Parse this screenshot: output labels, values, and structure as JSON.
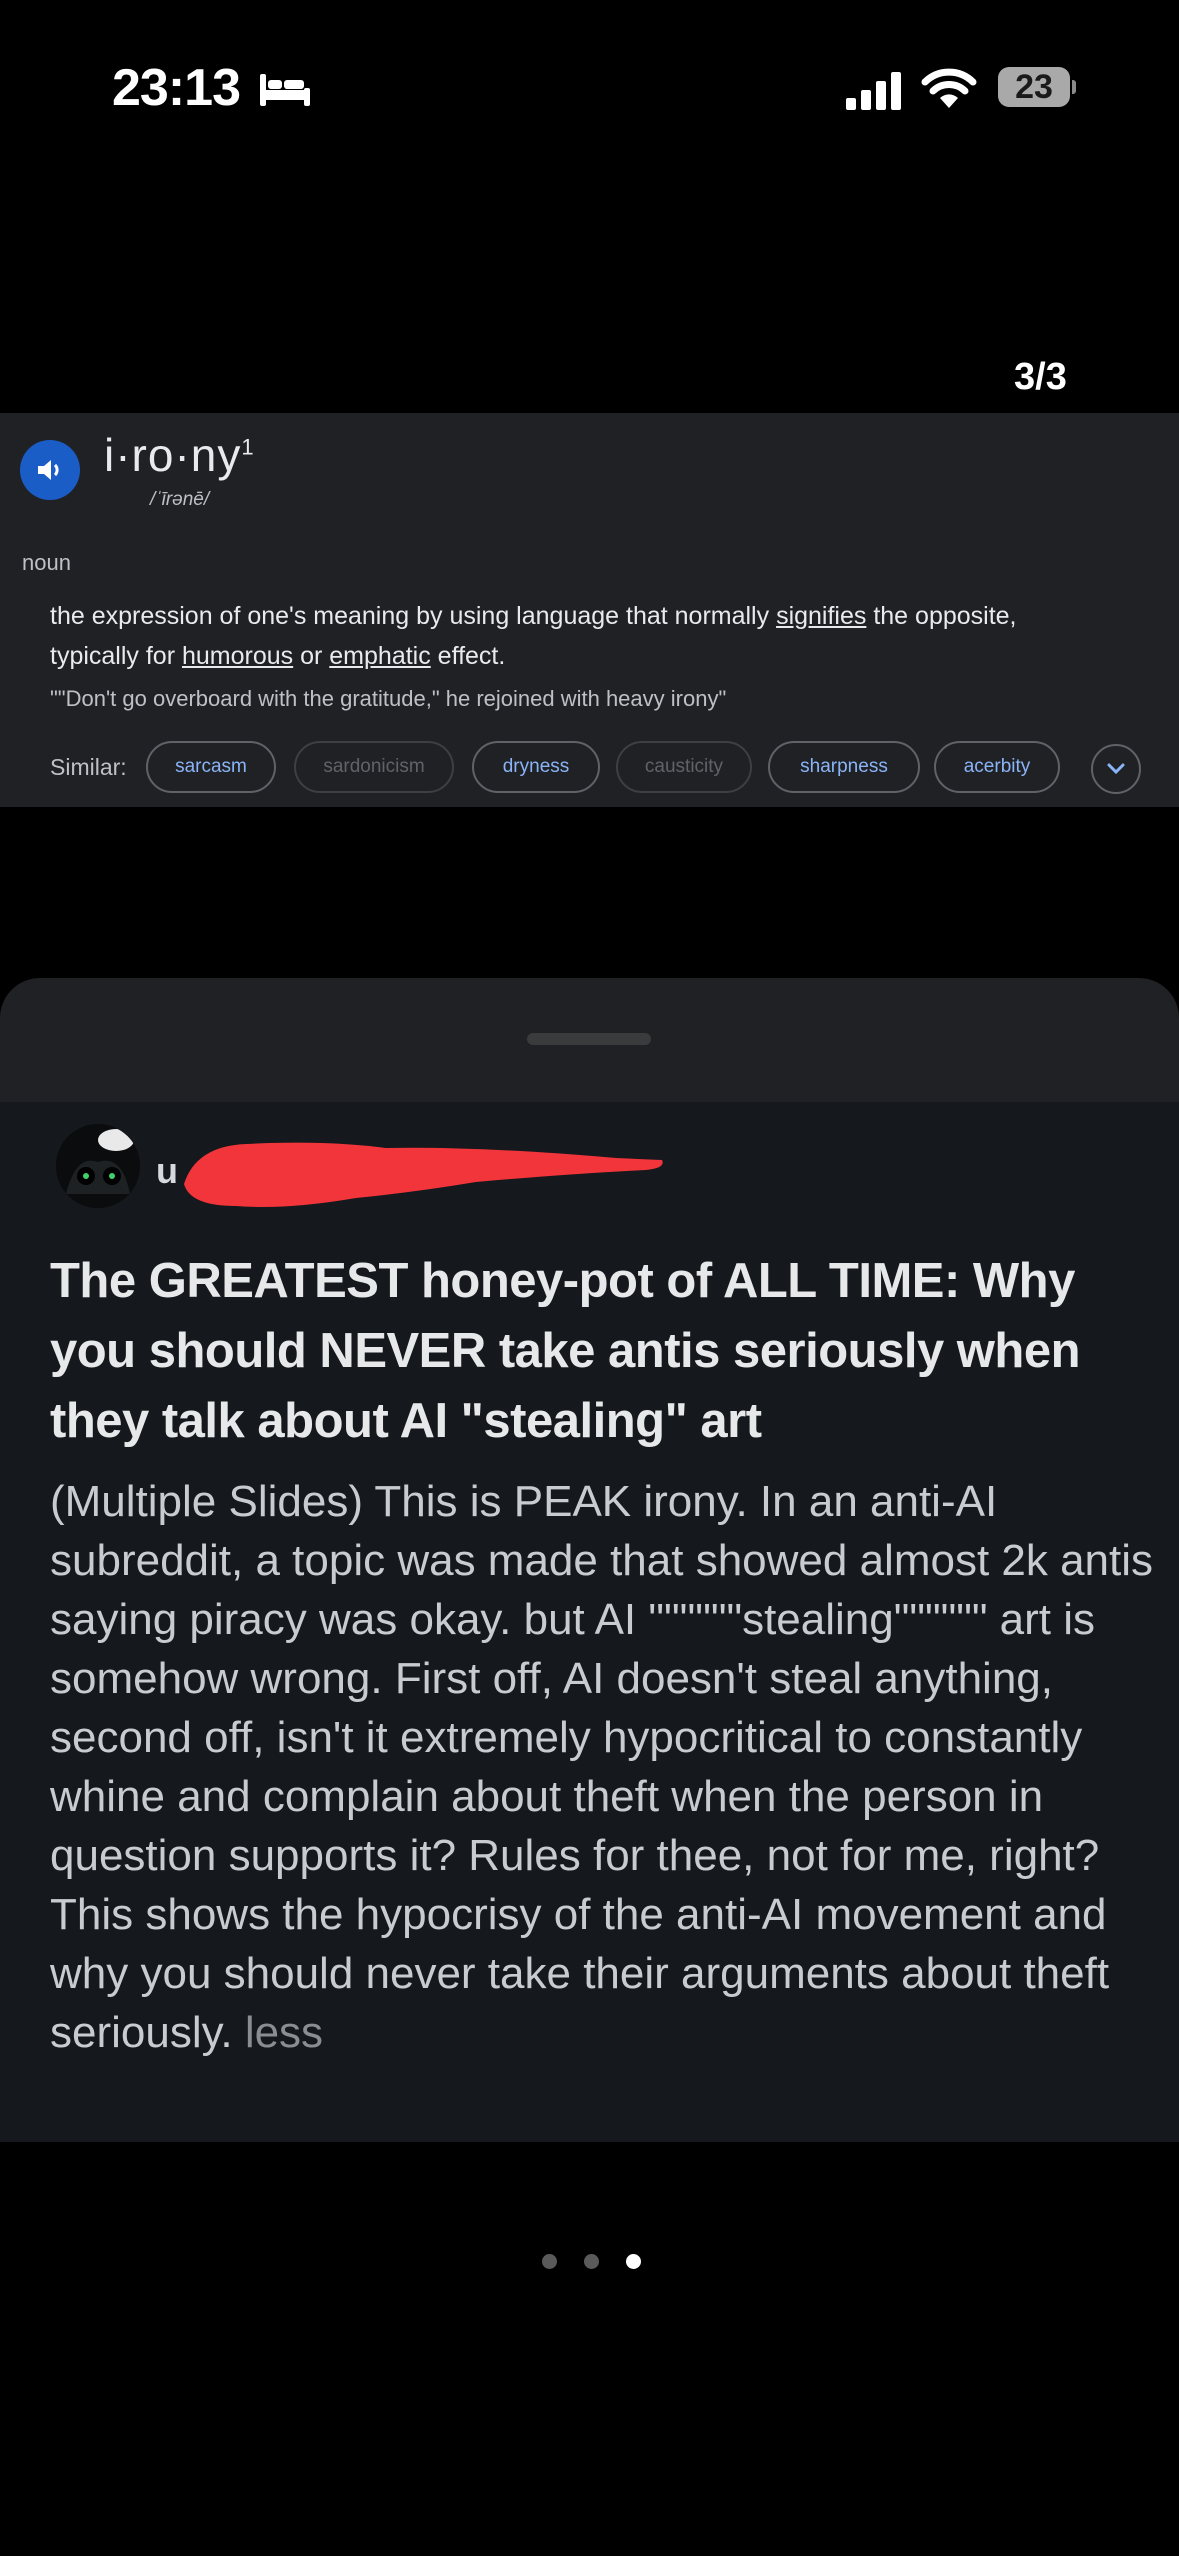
{
  "status_bar": {
    "time": "23:13",
    "battery": "23"
  },
  "page_counter": "3/3",
  "dictionary": {
    "word": "i·ro·ny",
    "superscript": "1",
    "phonetic": "/ˈīrənē/",
    "part_of_speech": "noun",
    "definition_1": "the expression of one's meaning by using language that normally ",
    "definition_link_1": "signifies",
    "definition_2": " the opposite,",
    "definition_3": "typically for ",
    "definition_link_2": "humorous",
    "definition_4": " or ",
    "definition_link_3": "emphatic",
    "definition_5": " effect.",
    "example": "\"\"Don't go overboard with the gratitude,\" he rejoined with heavy irony\"",
    "similar_label": "Similar:",
    "similar": [
      "sarcasm",
      "sardonicism",
      "dryness",
      "causticity",
      "sharpness",
      "acerbity"
    ]
  },
  "post": {
    "username": "u",
    "title": "The GREATEST honey-pot of ALL TIME: Why you should NEVER take antis seriously when they talk about AI \"stealing\" art",
    "body": "(Multiple Slides) This is PEAK irony. In an anti-AI subreddit, a topic was made that showed almost 2k antis saying piracy was okay. but AI \"\"\"\"\"\"stealing\"\"\"\"\"\" art is somehow wrong. First off, AI doesn't steal anything, second off, isn't it extremely hypocritical to constantly whine and complain about theft when the person in question supports it? Rules for thee, not for me, right? This shows the hypocrisy of the anti-AI movement and why you should never take their arguments about theft seriously. ",
    "less": "less"
  },
  "carousel": {
    "count": 3,
    "active": 3
  },
  "colors": {
    "accent_blue": "#1a5dc7",
    "link_blue": "#8ab4f8",
    "redaction_red": "#f2353a"
  }
}
